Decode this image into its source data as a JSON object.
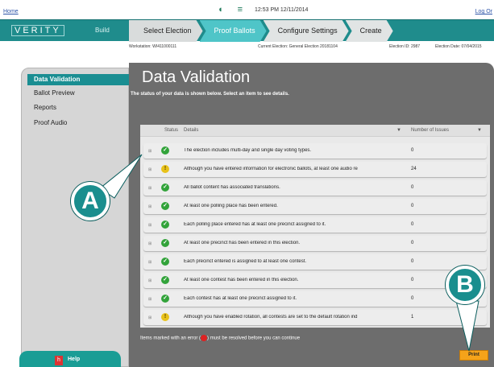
{
  "topbar": {
    "home": "Home",
    "logout": "Log Or",
    "datetime": "12:53 PM 12/11/2014"
  },
  "header": {
    "brand": "VERITY",
    "build": "Build",
    "tabs": [
      {
        "label": "Select Election"
      },
      {
        "label": "Proof Ballots"
      },
      {
        "label": "Configure Settings"
      },
      {
        "label": "Create"
      }
    ],
    "accent": "#1f8c8c"
  },
  "infostrip": {
    "workstation": "Workstation: WI411000111",
    "current_election": "Current Election: General Election 20181104",
    "election_id": "Election ID: 2987",
    "election_date": "Election Date: 07/04/2015"
  },
  "sidebar": {
    "items": [
      {
        "label": "Data Validation"
      },
      {
        "label": "Ballot Preview"
      },
      {
        "label": "Reports"
      },
      {
        "label": "Proof Audio"
      }
    ],
    "help": "Help"
  },
  "main": {
    "title": "Data Validation",
    "instructions": "The status of your data is shown below. Select an item to see details.",
    "columns": {
      "status": "Status",
      "details": "Details",
      "issues": "Number of Issues"
    },
    "rows": [
      {
        "status": "ok",
        "details": "The election includes multi-day and single day voting types.",
        "issues": "0"
      },
      {
        "status": "warn",
        "details": "Although you have entered information for electronic ballots, at least one audio re",
        "issues": "24"
      },
      {
        "status": "ok",
        "details": "All ballot content has associated translations.",
        "issues": "0"
      },
      {
        "status": "ok",
        "details": "At least one polling place has been entered.",
        "issues": "0"
      },
      {
        "status": "ok",
        "details": "Each polling place entered has at least one precinct assigned to it.",
        "issues": "0"
      },
      {
        "status": "ok",
        "details": "At least one precinct has been entered in this election.",
        "issues": "0"
      },
      {
        "status": "ok",
        "details": "Each precinct entered is assigned to at least one contest.",
        "issues": "0"
      },
      {
        "status": "ok",
        "details": "At least one contest has been entered in this election.",
        "issues": "0"
      },
      {
        "status": "ok",
        "details": "Each contest has at least one precinct assigned to it.",
        "issues": "0"
      },
      {
        "status": "warn",
        "details": "Although you have enabled rotation, all contests are set to the default rotation ind",
        "issues": "1"
      }
    ],
    "footnote_pre": "Items marked with an error (",
    "footnote_post": ") must be resolved before you can continue",
    "print": "Print"
  },
  "callouts": {
    "a": "A",
    "b": "B"
  }
}
